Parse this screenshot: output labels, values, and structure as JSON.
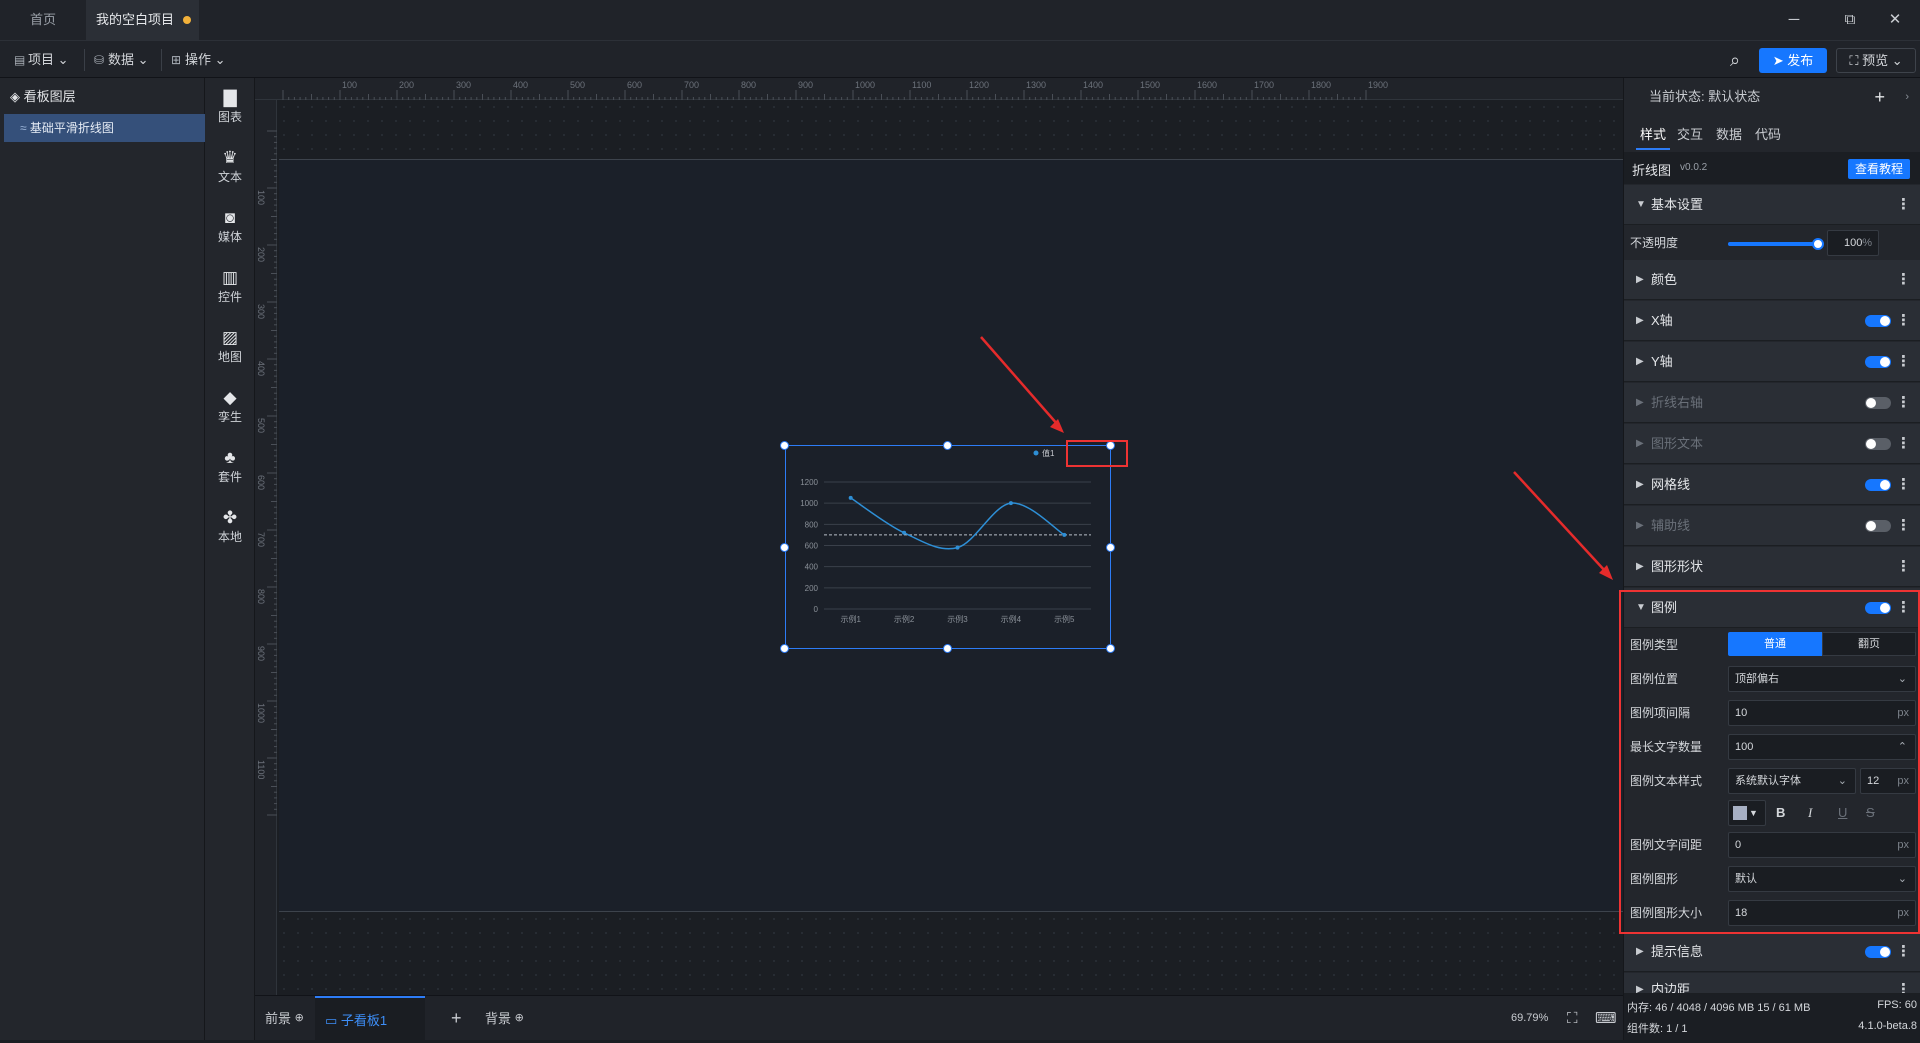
{
  "tabs": {
    "home": "首页",
    "project": "我的空白项目"
  },
  "window_controls": {
    "minimize": "─",
    "restore": "⧉",
    "close": "✕"
  },
  "toolbar": {
    "project": "项目",
    "data": "数据",
    "operate": "操作",
    "publish": "发布",
    "preview": "预览"
  },
  "layers": {
    "title": "看板图层",
    "item": "基础平滑折线图"
  },
  "components": [
    "图表",
    "文本",
    "媒体",
    "控件",
    "地图",
    "孪生",
    "套件",
    "本地"
  ],
  "ruler_top": [
    "100",
    "200",
    "300",
    "400",
    "500",
    "600",
    "700",
    "800",
    "900",
    "1000",
    "1100",
    "1200",
    "1300",
    "1400",
    "1500",
    "1600",
    "1700",
    "1800",
    "1900"
  ],
  "ruler_left": [
    "100",
    "200",
    "300",
    "400",
    "500",
    "600",
    "700",
    "800",
    "900",
    "1000",
    "1100"
  ],
  "chart_data": {
    "type": "line",
    "categories": [
      "示例1",
      "示例2",
      "示例3",
      "示例4",
      "示例5"
    ],
    "series": [
      {
        "name": "值1",
        "values": [
          1050,
          720,
          580,
          1000,
          700
        ]
      }
    ],
    "ylim": [
      0,
      1200
    ],
    "yticks": [
      "1200",
      "1000",
      "800",
      "600",
      "400",
      "200",
      "0"
    ],
    "mark_line": 700,
    "legend": "top-right",
    "grid": true,
    "color": "#2e8fd6"
  },
  "bottom": {
    "front": "前景",
    "sub_board": "子看板1",
    "add": "+",
    "background": "背景",
    "zoom": "69.79%"
  },
  "props": {
    "state": "当前状态:  默认状态",
    "tabs": [
      "样式",
      "交互",
      "数据",
      "代码"
    ],
    "component": "折线图",
    "version": "v0.0.2",
    "tutorial": "查看教程",
    "basic": "基本设置",
    "opacity_label": "不透明度",
    "opacity_value": "100",
    "opacity_unit": "%",
    "opacity_fraction": 1.0,
    "sections": {
      "color": "颜色",
      "xaxis": "X轴",
      "yaxis": "Y轴",
      "right_axis": "折线右轴",
      "shape_text": "图形文本",
      "grid": "网格线",
      "aux": "辅助线",
      "shape": "图形形状",
      "legend": "图例",
      "tooltip": "提示信息",
      "padding": "内边距"
    },
    "legend_fields": {
      "type_label": "图例类型",
      "type_normal": "普通",
      "type_page": "翻页",
      "position_label": "图例位置",
      "position_value": "顶部偏右",
      "spacing_label": "图例项间隔",
      "spacing_value": "10",
      "maxchars_label": "最长文字数量",
      "maxchars_value": "100",
      "textstyle_label": "图例文本样式",
      "font_value": "系统默认字体",
      "font_size": "12",
      "gap_label": "图例文字间距",
      "gap_value": "0",
      "shape_label": "图例图形",
      "shape_value": "默认",
      "shapesize_label": "图例图形大小",
      "shapesize_value": "18",
      "unit": "px"
    },
    "status": {
      "memory": "内存:  46 / 4048 / 4096 MB  15 / 61 MB",
      "fps": "FPS:  60",
      "count": "组件数: 1 / 1",
      "version": "4.1.0-beta.8"
    }
  }
}
